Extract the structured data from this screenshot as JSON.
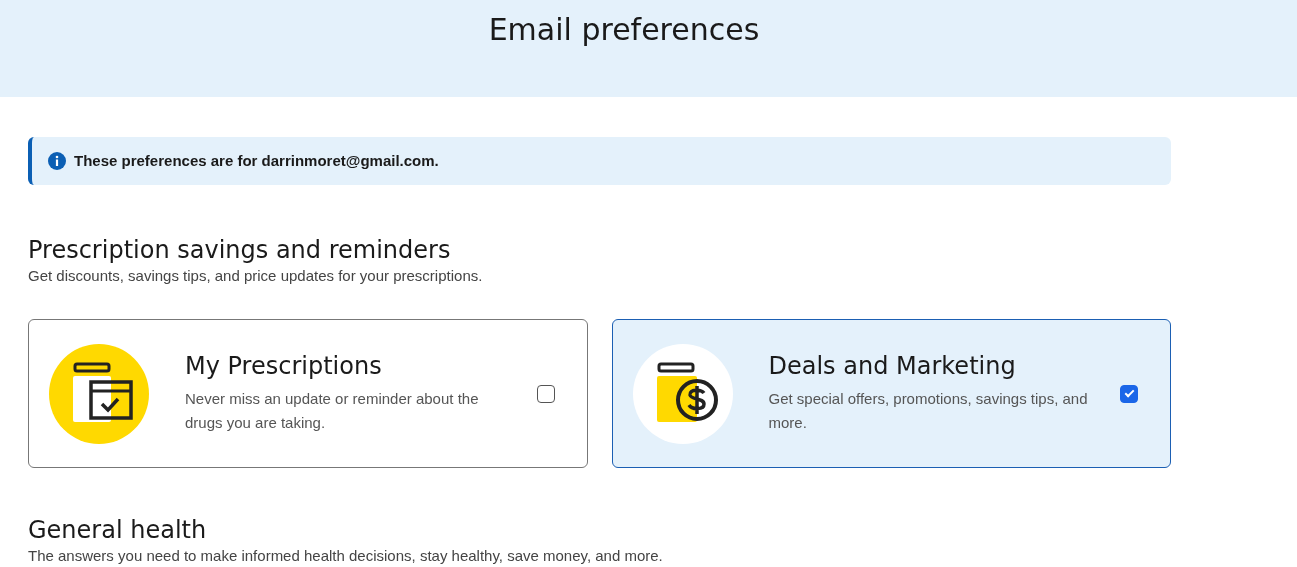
{
  "header": {
    "title": "Email preferences"
  },
  "notice": {
    "text": "These preferences are for darrinmoret@gmail.com."
  },
  "sections": [
    {
      "title": "Prescription savings and reminders",
      "subtitle": "Get discounts, savings tips, and price updates for your prescriptions.",
      "options": [
        {
          "kind": "calendar",
          "title": "My Prescriptions",
          "description": "Never miss an update or reminder about the drugs you are taking.",
          "checked": false
        },
        {
          "kind": "dollar",
          "title": "Deals and Marketing",
          "description": "Get special offers, promotions, savings tips, and more.",
          "checked": true
        }
      ]
    },
    {
      "title": "General health",
      "subtitle": "The answers you need to make informed health decisions, stay healthy, save money, and more."
    }
  ]
}
